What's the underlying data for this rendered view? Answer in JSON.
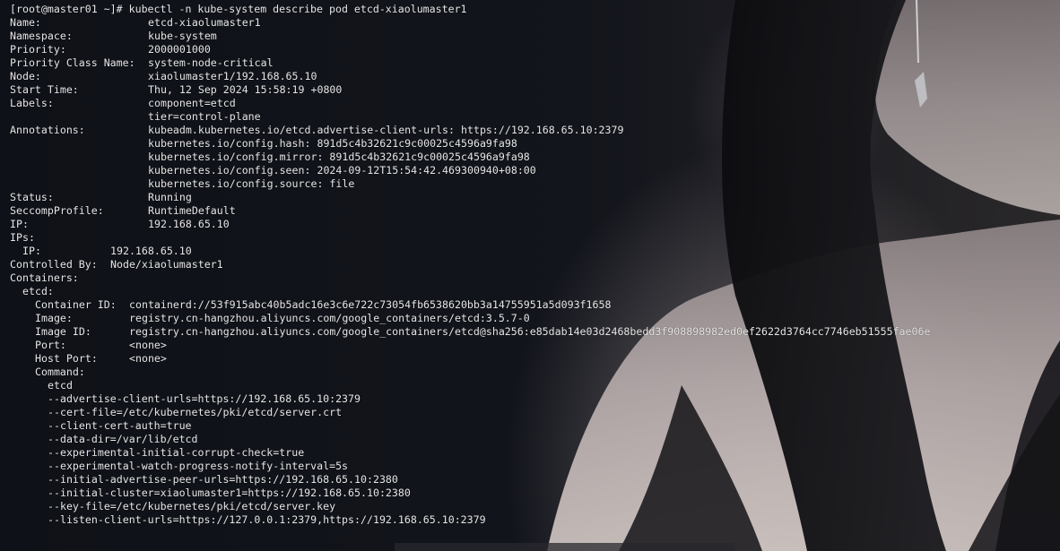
{
  "terminal": {
    "prompt": "[root@master01 ~]# kubectl -n kube-system describe pod etcd-xiaolumaster1",
    "fields": [
      {
        "label": "Name:",
        "value": "etcd-xiaolumaster1"
      },
      {
        "label": "Namespace:",
        "value": "kube-system"
      },
      {
        "label": "Priority:",
        "value": "2000001000"
      },
      {
        "label": "Priority Class Name:",
        "value": "system-node-critical"
      },
      {
        "label": "Node:",
        "value": "xiaolumaster1/192.168.65.10"
      },
      {
        "label": "Start Time:",
        "value": "Thu, 12 Sep 2024 15:58:19 +0800"
      },
      {
        "label": "Labels:",
        "value": "component=etcd"
      },
      {
        "label": "",
        "value": "tier=control-plane"
      },
      {
        "label": "Annotations:",
        "value": "kubeadm.kubernetes.io/etcd.advertise-client-urls: https://192.168.65.10:2379"
      },
      {
        "label": "",
        "value": "kubernetes.io/config.hash: 891d5c4b32621c9c00025c4596a9fa98"
      },
      {
        "label": "",
        "value": "kubernetes.io/config.mirror: 891d5c4b32621c9c00025c4596a9fa98"
      },
      {
        "label": "",
        "value": "kubernetes.io/config.seen: 2024-09-12T15:54:42.469300940+08:00"
      },
      {
        "label": "",
        "value": "kubernetes.io/config.source: file"
      },
      {
        "label": "Status:",
        "value": "Running"
      },
      {
        "label": "SeccompProfile:",
        "value": "RuntimeDefault"
      },
      {
        "label": "IP:",
        "value": "192.168.65.10"
      }
    ],
    "ips_label": "IPs:",
    "ips_ip_label": "IP:",
    "ips_ip_value": "192.168.65.10",
    "controlled_by_label": "Controlled By:",
    "controlled_by_value": "Node/xiaolumaster1",
    "containers_label": "Containers:",
    "container_name": "etcd:",
    "container_fields": [
      {
        "label": "Container ID:",
        "value": "containerd://53f915abc40b5adc16e3c6e722c73054fb6538620bb3a14755951a5d093f1658"
      },
      {
        "label": "Image:",
        "value": "registry.cn-hangzhou.aliyuncs.com/google_containers/etcd:3.5.7-0"
      },
      {
        "label": "Image ID:",
        "value": "registry.cn-hangzhou.aliyuncs.com/google_containers/etcd@sha256:e85dab14e03d2468bedd3f908898982ed0ef2622d3764cc7746eb51555fae06e"
      },
      {
        "label": "Port:",
        "value": "<none>"
      },
      {
        "label": "Host Port:",
        "value": "<none>"
      }
    ],
    "command_label": "Command:",
    "command_lines": [
      "etcd",
      "--advertise-client-urls=https://192.168.65.10:2379",
      "--cert-file=/etc/kubernetes/pki/etcd/server.crt",
      "--client-cert-auth=true",
      "--data-dir=/var/lib/etcd",
      "--experimental-initial-corrupt-check=true",
      "--experimental-watch-progress-notify-interval=5s",
      "--initial-advertise-peer-urls=https://192.168.65.10:2380",
      "--initial-cluster=xiaolumaster1=https://192.168.65.10:2380",
      "--key-file=/etc/kubernetes/pki/etcd/server.key",
      "--listen-client-urls=https://127.0.0.1:2379,https://192.168.65.10:2379"
    ]
  },
  "colors": {
    "text": "#e6e6e6",
    "background": "#101116"
  }
}
